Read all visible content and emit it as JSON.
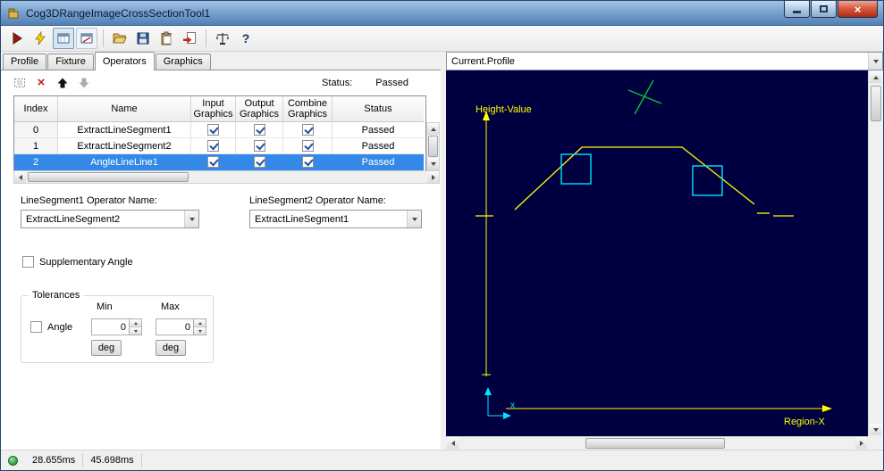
{
  "window": {
    "title": "Cog3DRangeImageCrossSectionTool1"
  },
  "toolbar": {
    "icons": [
      "run",
      "electric-run",
      "image-display",
      "graphics-display",
      "open",
      "save",
      "paste",
      "import",
      "tools",
      "help"
    ],
    "help_glyph": "?"
  },
  "tabs": [
    {
      "label": "Profile",
      "active": false
    },
    {
      "label": "Fixture",
      "active": false
    },
    {
      "label": "Operators",
      "active": true
    },
    {
      "label": "Graphics",
      "active": false
    }
  ],
  "operators": {
    "status_label": "Status:",
    "status_value": "Passed",
    "table": {
      "headers": [
        "Index",
        "Name",
        "Input Graphics",
        "Output Graphics",
        "Combine Graphics",
        "Status"
      ],
      "rows": [
        {
          "index": "0",
          "name": "ExtractLineSegment1",
          "input_graphics": true,
          "output_graphics": true,
          "combine_graphics": true,
          "status": "Passed",
          "selected": false
        },
        {
          "index": "1",
          "name": "ExtractLineSegment2",
          "input_graphics": true,
          "output_graphics": true,
          "combine_graphics": true,
          "status": "Passed",
          "selected": false
        },
        {
          "index": "2",
          "name": "AngleLineLine1",
          "input_graphics": true,
          "output_graphics": true,
          "combine_graphics": true,
          "status": "Passed",
          "selected": true
        }
      ]
    },
    "linesegment1": {
      "label": "LineSegment1 Operator Name:",
      "value": "ExtractLineSegment2"
    },
    "linesegment2": {
      "label": "LineSegment2 Operator Name:",
      "value": "ExtractLineSegment1"
    },
    "supplementary": {
      "label": "Supplementary Angle",
      "checked": false
    },
    "tolerances": {
      "group_label": "Tolerances",
      "min_label": "Min",
      "max_label": "Max",
      "angle": {
        "label": "Angle",
        "checked": false
      },
      "min_value": "0",
      "max_value": "0",
      "min_unit": "deg",
      "max_unit": "deg"
    }
  },
  "graphics": {
    "selector_value": "Current.Profile",
    "y_axis_label": "Height-Value",
    "x_axis_label": "Region-X",
    "origin_label": "x",
    "colors": {
      "background": "#000040",
      "profile": "#ffff00",
      "axis": "#ffff00",
      "segment_box": "#00e5ff",
      "origin": "#00e5ff",
      "angle_marker": "#00c832"
    },
    "profile_segments": [
      "33,163 53,163",
      "77,156 152,86 264,86 345,150",
      "348,160 362,160",
      "366,163 389,163"
    ]
  },
  "status_bar": {
    "time1": "28.655ms",
    "time2": "45.698ms"
  }
}
